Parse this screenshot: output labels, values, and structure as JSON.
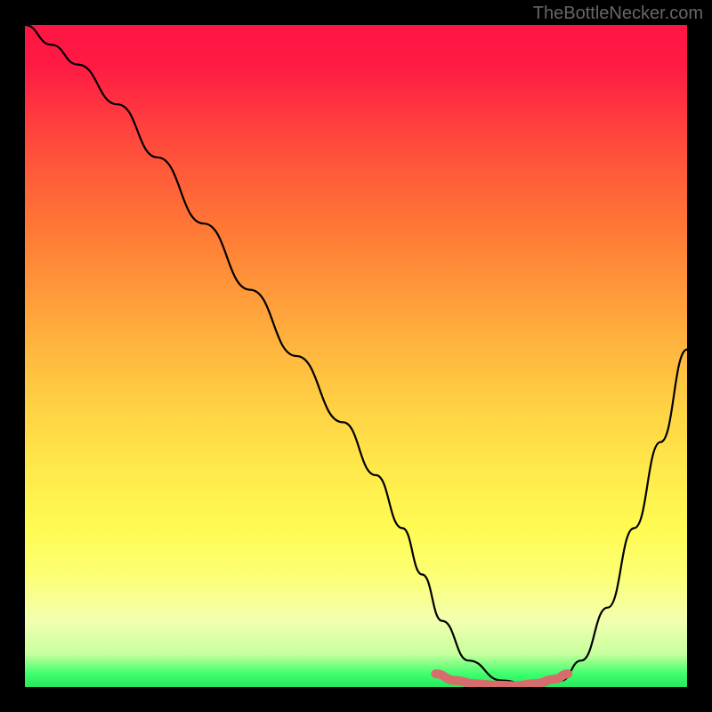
{
  "watermark": "TheBottleNecker.com",
  "chart_data": {
    "type": "line",
    "title": "",
    "xlabel": "",
    "ylabel": "",
    "xlim": [
      0,
      100
    ],
    "ylim": [
      0,
      100
    ],
    "series": [
      {
        "name": "curve",
        "x": [
          0,
          4,
          8,
          14,
          20,
          27,
          34,
          41,
          48,
          53,
          57,
          60,
          63,
          67,
          72,
          77,
          81,
          84,
          88,
          92,
          96,
          100
        ],
        "y": [
          100,
          97,
          94,
          88,
          80,
          70,
          60,
          50,
          40,
          32,
          24,
          17,
          10,
          4,
          1,
          0,
          1,
          4,
          12,
          24,
          37,
          51
        ]
      },
      {
        "name": "highlight",
        "x": [
          62,
          65,
          68,
          71,
          74,
          77,
          80,
          82
        ],
        "y": [
          2,
          1,
          0.5,
          0.3,
          0.2,
          0.5,
          1.2,
          2
        ]
      }
    ],
    "gradient_note": "background encodes magnitude: red=high, green=low"
  }
}
